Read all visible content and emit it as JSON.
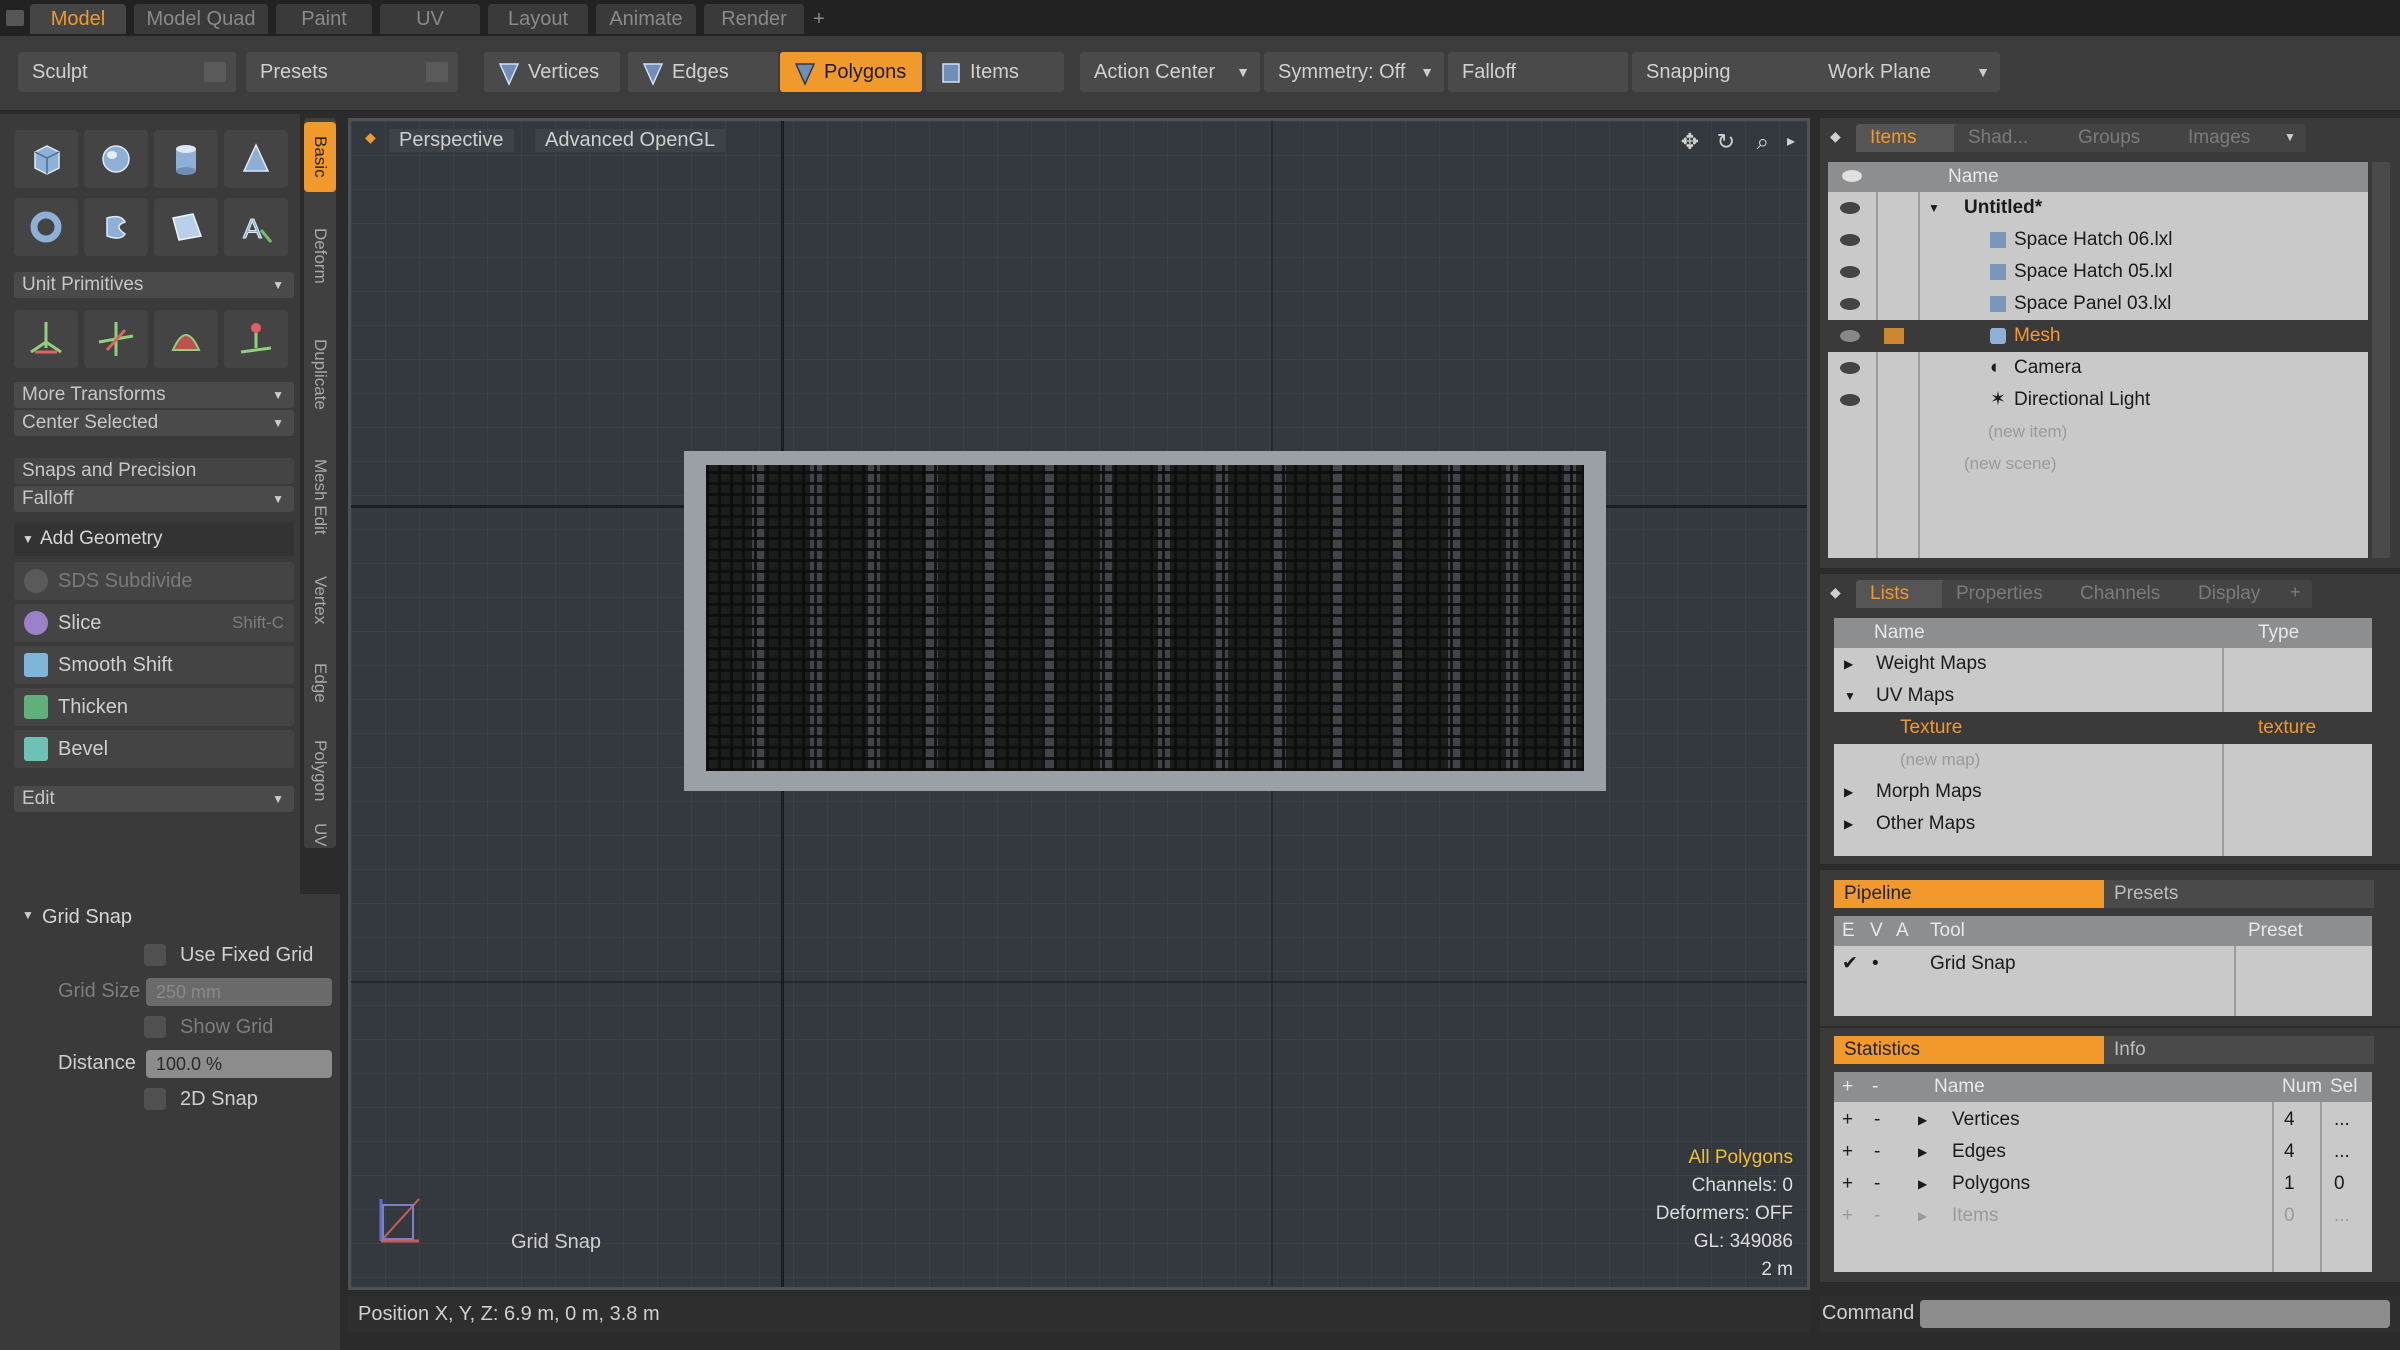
{
  "mode_tabs": [
    "Model",
    "Model Quad",
    "Paint",
    "UV",
    "Layout",
    "Animate",
    "Render",
    "+"
  ],
  "toolbar": {
    "sculpt": "Sculpt",
    "presets": "Presets",
    "vertices": "Vertices",
    "edges": "Edges",
    "polygons": "Polygons",
    "items": "Items",
    "action_center": "Action Center",
    "symmetry": "Symmetry: Off",
    "falloff": "Falloff",
    "snapping": "Snapping",
    "work_plane": "Work Plane"
  },
  "left": {
    "unit_primitives": "Unit Primitives",
    "more_transforms": "More Transforms",
    "center_selected": "Center Selected",
    "snaps_precision": "Snaps and Precision",
    "falloff": "Falloff",
    "add_geometry": "Add Geometry",
    "tools": [
      "SDS Subdivide",
      "Slice",
      "Smooth Shift",
      "Thicken",
      "Bevel"
    ],
    "slice_shortcut": "Shift-C",
    "edit": "Edit"
  },
  "vtabs": [
    "Basic",
    "Deform",
    "Duplicate",
    "Mesh Edit",
    "Vertex",
    "Edge",
    "Polygon",
    "UV"
  ],
  "gridsnap": {
    "title": "Grid Snap",
    "use_fixed_grid": "Use Fixed Grid",
    "grid_size_label": "Grid Size",
    "grid_size_value": "250 mm",
    "show_grid": "Show Grid",
    "distance_label": "Distance",
    "distance_value": "100.0 %",
    "snap_2d": "2D Snap"
  },
  "viewport": {
    "view": "Perspective",
    "shading": "Advanced OpenGL",
    "tool_name": "Grid Snap",
    "overlay": {
      "all_polygons": "All Polygons",
      "channels": "Channels: 0",
      "deformers": "Deformers: OFF",
      "gl": "GL: 349086",
      "scale": "2 m"
    }
  },
  "status": {
    "position": "Position X, Y, Z:  6.9 m, 0 m, 3.8 m"
  },
  "items_panel": {
    "tabs": [
      "Items",
      "Shad...",
      "Groups",
      "Images"
    ],
    "header": "Name",
    "rows": [
      {
        "name": "Untitled*"
      },
      {
        "name": "Space Hatch 06.lxl"
      },
      {
        "name": "Space Hatch 05.lxl"
      },
      {
        "name": "Space Panel 03.lxl"
      },
      {
        "name": "Mesh"
      },
      {
        "name": "Camera"
      },
      {
        "name": "Directional Light"
      },
      {
        "name": "(new item)"
      },
      {
        "name": "(new scene)"
      }
    ]
  },
  "lists_panel": {
    "tabs": [
      "Lists",
      "Properties",
      "Channels",
      "Display"
    ],
    "header_name": "Name",
    "header_type": "Type",
    "rows": [
      {
        "name": "Weight Maps",
        "type": ""
      },
      {
        "name": "UV Maps",
        "type": ""
      },
      {
        "name": "Texture",
        "type": "texture"
      },
      {
        "name": "(new map)",
        "type": ""
      },
      {
        "name": "Morph Maps",
        "type": ""
      },
      {
        "name": "Other Maps",
        "type": ""
      }
    ]
  },
  "pipeline": {
    "tab_active": "Pipeline",
    "tab_other": "Presets",
    "headers": [
      "E",
      "V",
      "A",
      "Tool",
      "Preset"
    ],
    "rows": [
      {
        "tool": "Grid Snap"
      }
    ]
  },
  "statistics": {
    "tab_active": "Statistics",
    "tab_other": "Info",
    "headers": [
      "+",
      "-",
      "Name",
      "Num",
      "Sel"
    ],
    "rows": [
      {
        "name": "Vertices",
        "num": "4",
        "sel": "..."
      },
      {
        "name": "Edges",
        "num": "4",
        "sel": "..."
      },
      {
        "name": "Polygons",
        "num": "1",
        "sel": "0"
      },
      {
        "name": "Items",
        "num": "0",
        "sel": "..."
      }
    ]
  },
  "command": {
    "label": "Command"
  }
}
